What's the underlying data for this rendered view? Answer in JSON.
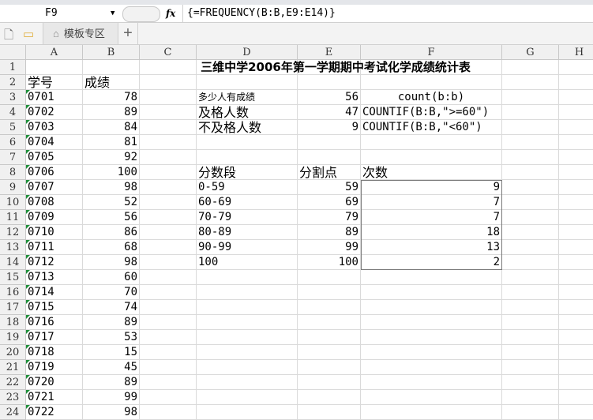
{
  "formula_bar": {
    "name_box": "F9",
    "formula": "{=FREQUENCY(B:B,E9:E14)}",
    "fx_label": "fx"
  },
  "tabs": {
    "template_tab": "模板专区",
    "new_tab": "+"
  },
  "columns": [
    "A",
    "B",
    "C",
    "D",
    "E",
    "F",
    "G",
    "H"
  ],
  "title": "三维中学2006年第一学期期中考试化学成绩统计表",
  "headers": {
    "id": "学号",
    "score": "成绩"
  },
  "students": [
    [
      "0701",
      "78"
    ],
    [
      "0702",
      "89"
    ],
    [
      "0703",
      "84"
    ],
    [
      "0704",
      "81"
    ],
    [
      "0705",
      "92"
    ],
    [
      "0706",
      "100"
    ],
    [
      "0707",
      "98"
    ],
    [
      "0708",
      "52"
    ],
    [
      "0709",
      "56"
    ],
    [
      "0710",
      "86"
    ],
    [
      "0711",
      "68"
    ],
    [
      "0712",
      "98"
    ],
    [
      "0713",
      "60"
    ],
    [
      "0714",
      "70"
    ],
    [
      "0715",
      "74"
    ],
    [
      "0716",
      "89"
    ],
    [
      "0717",
      "53"
    ],
    [
      "0718",
      "15"
    ],
    [
      "0719",
      "45"
    ],
    [
      "0720",
      "89"
    ],
    [
      "0721",
      "99"
    ],
    [
      "0722",
      "98"
    ]
  ],
  "stats": [
    {
      "label": "多少人有成绩",
      "value": "56",
      "formula": "count(b:b)"
    },
    {
      "label": "及格人数",
      "value": "47",
      "formula": "COUNTIF(B:B,\">=60\")"
    },
    {
      "label": "不及格人数",
      "value": "9",
      "formula": "COUNTIF(B:B,\"<60\")"
    }
  ],
  "freq_headers": {
    "range": "分数段",
    "split": "分割点",
    "count": "次数"
  },
  "freq": [
    [
      "0-59",
      "59",
      "9"
    ],
    [
      "60-69",
      "69",
      "7"
    ],
    [
      "70-79",
      "79",
      "7"
    ],
    [
      "80-89",
      "89",
      "18"
    ],
    [
      "90-99",
      "99",
      "13"
    ],
    [
      "100",
      "100",
      "2"
    ]
  ]
}
